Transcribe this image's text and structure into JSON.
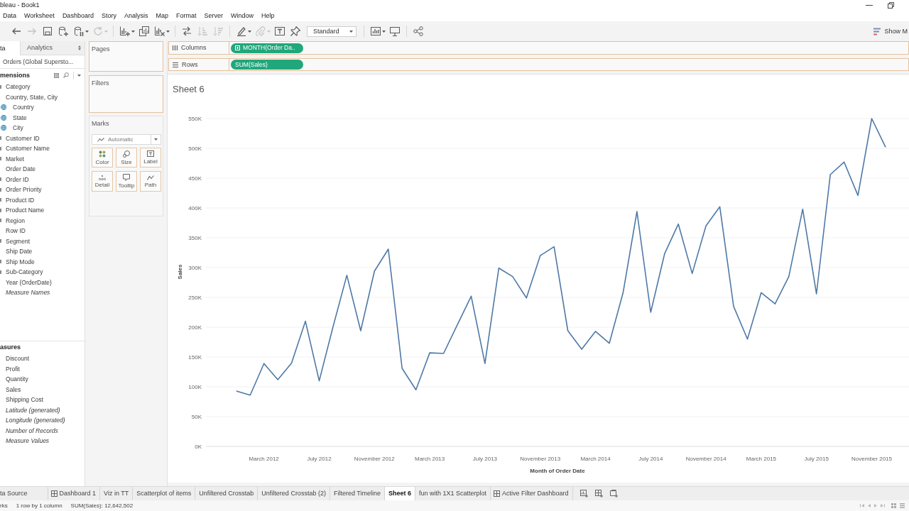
{
  "window": {
    "title": "bleau - Book1"
  },
  "menu": [
    "Data",
    "Worksheet",
    "Dashboard",
    "Story",
    "Analysis",
    "Map",
    "Format",
    "Server",
    "Window",
    "Help"
  ],
  "toolbar": {
    "groups": [
      [
        {
          "kind": "back",
          "disabled": false,
          "menu": false
        },
        {
          "kind": "forward",
          "disabled": true,
          "menu": false
        },
        {
          "kind": "save",
          "disabled": false,
          "menu": false
        },
        {
          "kind": "new_data_source",
          "disabled": false,
          "menu": false
        },
        {
          "kind": "pause_updates",
          "disabled": false,
          "menu": true
        },
        {
          "kind": "refresh",
          "disabled": true,
          "menu": true
        }
      ],
      [
        {
          "kind": "new_worksheet",
          "disabled": false,
          "menu": true
        },
        {
          "kind": "duplicate",
          "disabled": false,
          "menu": false
        },
        {
          "kind": "clear",
          "disabled": false,
          "menu": true
        }
      ],
      [
        {
          "kind": "swap",
          "disabled": false,
          "menu": false
        },
        {
          "kind": "sort_ascending",
          "disabled": true,
          "menu": false
        },
        {
          "kind": "sort_descending",
          "disabled": true,
          "menu": false
        }
      ],
      [
        {
          "kind": "highlight",
          "disabled": false,
          "menu": true
        },
        {
          "kind": "group",
          "disabled": true,
          "menu": true
        },
        {
          "kind": "labels",
          "disabled": false,
          "menu": false
        },
        {
          "kind": "fix_axes",
          "disabled": false,
          "menu": false
        },
        {
          "kind": "dropdown",
          "label": "Standard",
          "disabled": false
        }
      ],
      [
        {
          "kind": "cards",
          "disabled": false,
          "menu": true
        },
        {
          "kind": "presentation",
          "disabled": false,
          "menu": false
        }
      ],
      [
        {
          "kind": "share",
          "disabled": false,
          "menu": false
        }
      ]
    ],
    "show_me": "Show M"
  },
  "data_pane": {
    "tabs": [
      {
        "label": "ta",
        "selected": true
      },
      {
        "label": "Analytics",
        "selected": false
      }
    ],
    "data_source": "Orders (Global Supersto...",
    "dimensions": {
      "title": "mensions",
      "items": [
        {
          "label": "Category",
          "kind": "field"
        },
        {
          "label": "Country, State, City",
          "kind": "plain",
          "children": [
            {
              "label": "Country",
              "kind": "geo"
            },
            {
              "label": "State",
              "kind": "geo"
            },
            {
              "label": "City",
              "kind": "geo"
            }
          ]
        },
        {
          "label": "Customer ID",
          "kind": "field"
        },
        {
          "label": "Customer Name",
          "kind": "field"
        },
        {
          "label": "Market",
          "kind": "field"
        },
        {
          "label": "Order Date",
          "kind": "plain"
        },
        {
          "label": "Order ID",
          "kind": "field"
        },
        {
          "label": "Order Priority",
          "kind": "field"
        },
        {
          "label": "Product ID",
          "kind": "field"
        },
        {
          "label": "Product Name",
          "kind": "field"
        },
        {
          "label": "Region",
          "kind": "field"
        },
        {
          "label": "Row ID",
          "kind": "plain"
        },
        {
          "label": "Segment",
          "kind": "field"
        },
        {
          "label": "Ship Date",
          "kind": "plain"
        },
        {
          "label": "Ship Mode",
          "kind": "field"
        },
        {
          "label": "Sub-Category",
          "kind": "field"
        },
        {
          "label": "Year (OrderDate)",
          "kind": "plain"
        },
        {
          "label": "Measure Names",
          "kind": "generated"
        }
      ]
    },
    "measures": {
      "title": "asures",
      "items": [
        {
          "label": "Discount",
          "kind": "plain"
        },
        {
          "label": "Profit",
          "kind": "plain"
        },
        {
          "label": "Quantity",
          "kind": "plain"
        },
        {
          "label": "Sales",
          "kind": "plain"
        },
        {
          "label": "Shipping Cost",
          "kind": "plain"
        },
        {
          "label": "Latitude (generated)",
          "kind": "generated"
        },
        {
          "label": "Longitude (generated)",
          "kind": "generated"
        },
        {
          "label": "Number of Records",
          "kind": "generated"
        },
        {
          "label": "Measure Values",
          "kind": "generated"
        }
      ]
    }
  },
  "cards": {
    "pages": {
      "title": "Pages"
    },
    "filters": {
      "title": "Filters"
    },
    "marks": {
      "title": "Marks",
      "mark_type": "Automatic",
      "buttons": [
        {
          "label": "Color",
          "kind": "color"
        },
        {
          "label": "Size",
          "kind": "size"
        },
        {
          "label": "Label",
          "kind": "label"
        },
        {
          "label": "Detail",
          "kind": "detail"
        },
        {
          "label": "Tooltip",
          "kind": "tooltip"
        },
        {
          "label": "Path",
          "kind": "path"
        }
      ]
    }
  },
  "shelves": [
    {
      "label": "Columns",
      "kind": "columns",
      "pill": {
        "label": "MONTH(Order Da..",
        "drillable": true
      }
    },
    {
      "label": "Rows",
      "kind": "rows",
      "pill": {
        "label": "SUM(Sales)",
        "drillable": false
      }
    }
  ],
  "sheet": {
    "chart_data": {
      "type": "line",
      "title": "Sheet 6",
      "xlabel": "Month of Order Date",
      "ylabel": "Sales",
      "categories": [
        null,
        null,
        "March 2012",
        null,
        null,
        null,
        "July 2012",
        null,
        null,
        null,
        "November 2012",
        null,
        null,
        null,
        "March 2013",
        null,
        null,
        null,
        "July 2013",
        null,
        null,
        null,
        "November 2013",
        null,
        null,
        null,
        "March 2014",
        null,
        null,
        null,
        "July 2014",
        null,
        null,
        null,
        "November 2014",
        null,
        null,
        null,
        "March 2015",
        null,
        null,
        null,
        "July 2015",
        null,
        null,
        null,
        "November 2015",
        null
      ],
      "series": [
        {
          "color": "#4e79a7",
          "values": [
            93000,
            86000,
            139000,
            112000,
            140000,
            210000,
            110000,
            201000,
            287000,
            194000,
            294000,
            331000,
            131000,
            95000,
            157000,
            156000,
            204000,
            252000,
            139000,
            299000,
            285000,
            249000,
            320000,
            335000,
            194000,
            163000,
            193000,
            173000,
            258000,
            394000,
            225000,
            323000,
            373000,
            290000,
            370000,
            402000,
            235000,
            180000,
            258000,
            239000,
            285000,
            398000,
            256000,
            456000,
            477000,
            421000,
            550000,
            502000
          ]
        }
      ],
      "ylim": [
        0,
        550000
      ],
      "yticks": [
        {
          "value": 0,
          "label": "0K"
        },
        {
          "value": 50000,
          "label": "50K"
        },
        {
          "value": 100000,
          "label": "100K"
        },
        {
          "value": 150000,
          "label": "150K"
        },
        {
          "value": 200000,
          "label": "200K"
        },
        {
          "value": 250000,
          "label": "250K"
        },
        {
          "value": 300000,
          "label": "300K"
        },
        {
          "value": 350000,
          "label": "350K"
        },
        {
          "value": 400000,
          "label": "400K"
        },
        {
          "value": 450000,
          "label": "450K"
        },
        {
          "value": 500000,
          "label": "500K"
        },
        {
          "value": 550000,
          "label": "550K"
        }
      ],
      "grid": true
    }
  },
  "sheet_tabs": [
    {
      "label": "ta Source",
      "kind": "data_source",
      "selected": false
    },
    {
      "label": "Dashboard 1",
      "kind": "dashboard",
      "selected": false
    },
    {
      "label": "Viz in TT",
      "kind": "sheet",
      "selected": false
    },
    {
      "label": "Scatterplot of items",
      "kind": "sheet",
      "selected": false
    },
    {
      "label": "Unfiltered Crosstab",
      "kind": "sheet",
      "selected": false
    },
    {
      "label": "Unfiltered Crosstab (2)",
      "kind": "sheet",
      "selected": false
    },
    {
      "label": "Filtered Timeline",
      "kind": "sheet",
      "selected": false
    },
    {
      "label": "Sheet 6",
      "kind": "sheet",
      "selected": true
    },
    {
      "label": "fun with 1X1 Scatterplot",
      "kind": "sheet",
      "selected": false
    },
    {
      "label": "Active Filter Dashboard",
      "kind": "dashboard",
      "selected": false
    }
  ],
  "status_bar": [
    "rks",
    "1 row by 1 column",
    "SUM(Sales): 12,642,502"
  ]
}
